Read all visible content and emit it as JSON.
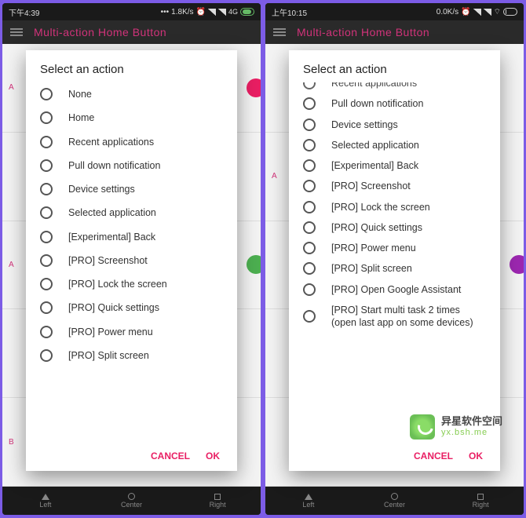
{
  "left_screen": {
    "statusbar": {
      "time": "下午4:39",
      "net": "1.8K/s",
      "sig4g": "4G"
    },
    "app_title": "Multi-action Home Button",
    "dialog": {
      "title": "Select an action",
      "items": [
        "None",
        "Home",
        "Recent applications",
        "Pull down notification",
        "Device settings",
        "Selected application",
        "[Experimental] Back",
        "[PRO] Screenshot",
        "[PRO] Lock the screen",
        "[PRO] Quick settings",
        "[PRO] Power menu",
        "[PRO] Split screen"
      ],
      "cancel": "CANCEL",
      "ok": "OK"
    },
    "bottombar": {
      "left": "Left",
      "center": "Center",
      "right": "Right"
    }
  },
  "right_screen": {
    "statusbar": {
      "time": "上午10:15",
      "net": "0.0K/s"
    },
    "app_title": "Multi-action Home Button",
    "dialog": {
      "title": "Select an action",
      "top_partial": "Recent applications",
      "items": [
        "Pull down notification",
        "Device settings",
        "Selected application",
        "[Experimental] Back",
        "[PRO] Screenshot",
        "[PRO] Lock the screen",
        "[PRO] Quick settings",
        "[PRO] Power menu",
        "[PRO] Split screen",
        "[PRO] Open Google Assistant",
        "[PRO] Start multi task 2 times (open last app on some devices)"
      ],
      "cancel": "CANCEL",
      "ok": "OK"
    },
    "bottombar": {
      "left": "Left",
      "center": "Center",
      "right": "Right"
    }
  },
  "watermark": {
    "line1": "异星软件空间",
    "line2": "yx.bsh.me"
  }
}
